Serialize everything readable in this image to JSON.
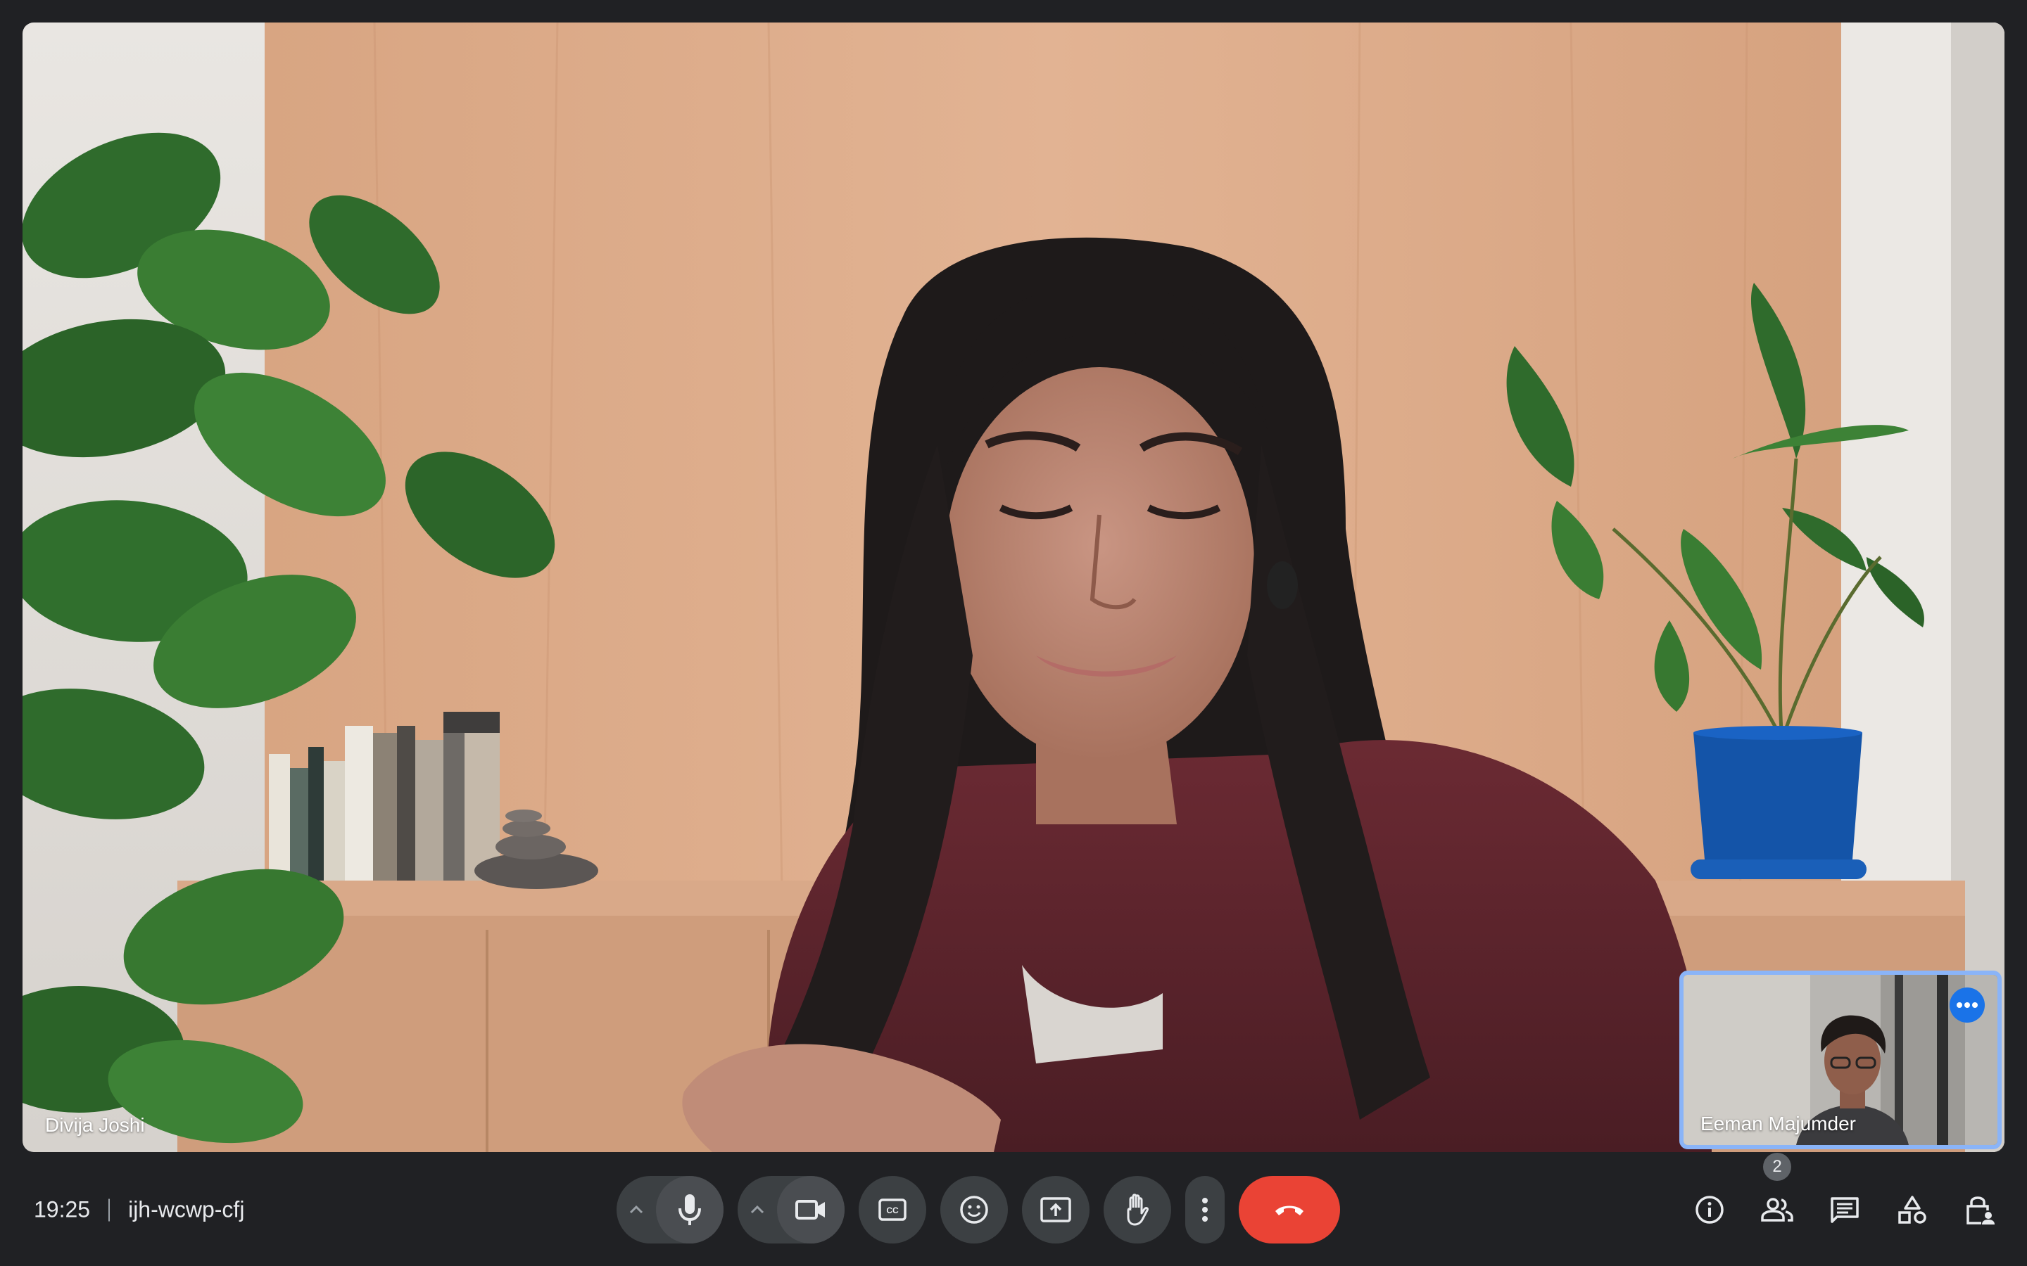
{
  "main_participant": {
    "name": "Divija Joshi"
  },
  "self_view": {
    "name": "Eeman Majumder",
    "more_icon": "more-horiz-icon"
  },
  "meeting": {
    "time": "19:25",
    "code": "ijh-wcwp-cfj"
  },
  "controls": {
    "audio_options_icon": "chevron-up-icon",
    "mic_icon": "mic-icon",
    "video_options_icon": "chevron-up-icon",
    "camera_icon": "videocam-icon",
    "captions_icon": "closed-captions-icon",
    "reactions_icon": "emoji-icon",
    "present_icon": "present-screen-icon",
    "raise_hand_icon": "hand-icon",
    "more_icon": "more-vert-icon",
    "leave_icon": "call-end-icon"
  },
  "side_controls": {
    "info_icon": "info-icon",
    "people_icon": "people-icon",
    "people_count": "2",
    "chat_icon": "chat-icon",
    "activities_icon": "shapes-icon",
    "host_controls_icon": "lock-person-icon"
  },
  "colors": {
    "background": "#202124",
    "control_surface": "#3c4043",
    "end_call": "#ea4335",
    "self_tile_border": "#8ab4f8",
    "accent_blue": "#1a73e8"
  }
}
